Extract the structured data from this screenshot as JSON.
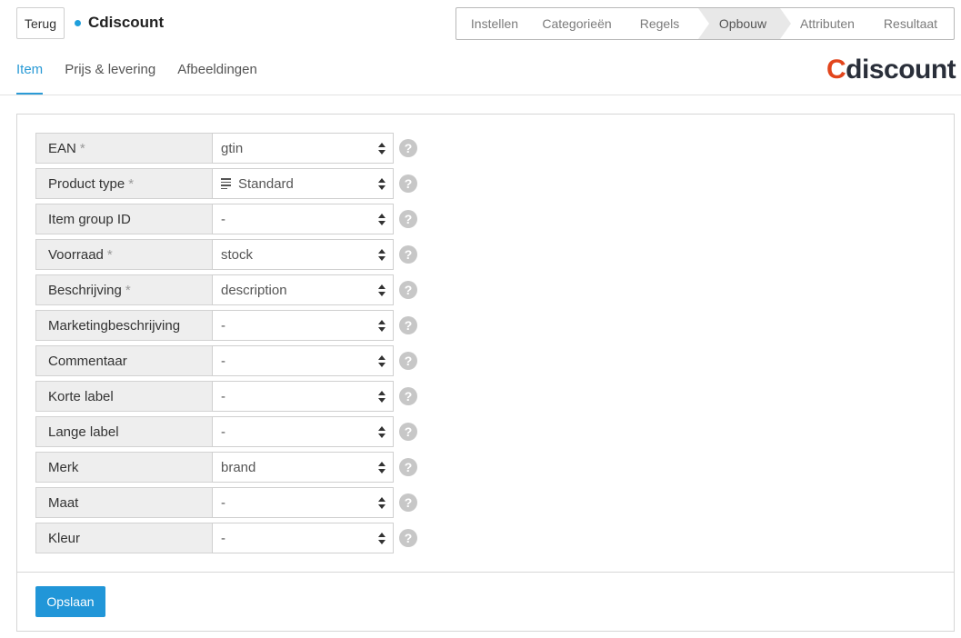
{
  "header": {
    "back_label": "Terug",
    "title": "Cdiscount",
    "status_color": "#1f9fdc"
  },
  "stepper": {
    "steps": [
      {
        "label": "Instellen"
      },
      {
        "label": "Categorieën"
      },
      {
        "label": "Regels"
      },
      {
        "label": "Opbouw"
      },
      {
        "label": "Attributen"
      },
      {
        "label": "Resultaat"
      }
    ],
    "active": "Opbouw"
  },
  "tabs": [
    {
      "label": "Item"
    },
    {
      "label": "Prijs & levering"
    },
    {
      "label": "Afbeeldingen"
    }
  ],
  "active_tab": "Item",
  "logo": {
    "first": "C",
    "rest": "discount",
    "accent": "#e2451c"
  },
  "fields": [
    {
      "label": "EAN",
      "required": "*",
      "value": "gtin"
    },
    {
      "label": "Product type",
      "required": "*",
      "value": "Standard",
      "icon": "list-icon"
    },
    {
      "label": "Item group ID",
      "required": "",
      "value": "-"
    },
    {
      "label": "Voorraad",
      "required": "*",
      "value": "stock"
    },
    {
      "label": "Beschrijving",
      "required": "*",
      "value": "description"
    },
    {
      "label": "Marketingbeschrijving",
      "required": "",
      "value": "-"
    },
    {
      "label": "Commentaar",
      "required": "",
      "value": "-"
    },
    {
      "label": "Korte label",
      "required": "",
      "value": "-"
    },
    {
      "label": "Lange label",
      "required": "",
      "value": "-"
    },
    {
      "label": "Merk",
      "required": "",
      "value": "brand"
    },
    {
      "label": "Maat",
      "required": "",
      "value": "-"
    },
    {
      "label": "Kleur",
      "required": "",
      "value": "-"
    }
  ],
  "help_glyph": "?",
  "save_label": "Opslaan",
  "accent_color": "#2196d8"
}
